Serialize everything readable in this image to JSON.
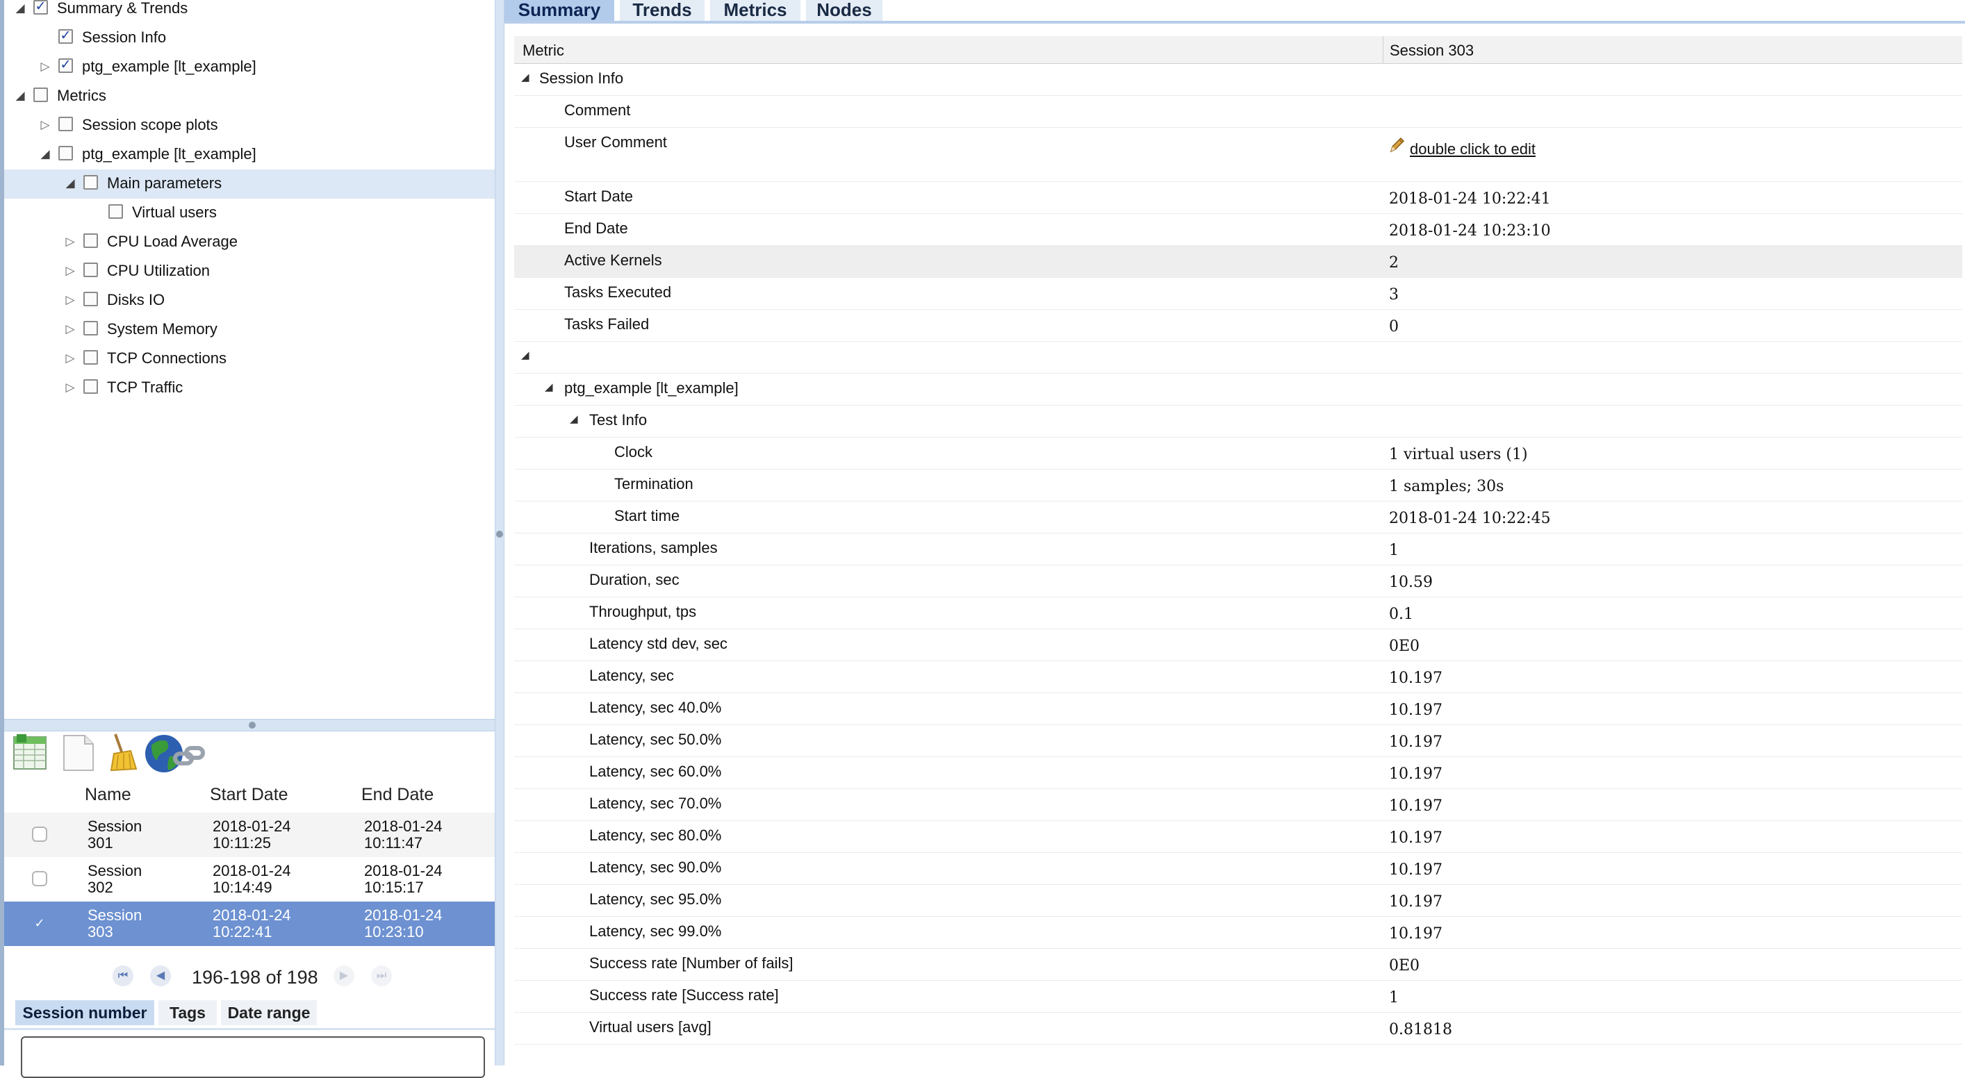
{
  "tree": [
    {
      "label": "Summary & Trends",
      "level": 0,
      "expander": "open",
      "checked": true
    },
    {
      "label": "Session Info",
      "level": 1,
      "expander": "none",
      "checked": true
    },
    {
      "label": "ptg_example [lt_example]",
      "level": 1,
      "expander": "closed",
      "checked": true
    },
    {
      "label": "Metrics",
      "level": 0,
      "expander": "open",
      "checked": false
    },
    {
      "label": "Session scope plots",
      "level": 1,
      "expander": "closed",
      "checked": false
    },
    {
      "label": "ptg_example [lt_example]",
      "level": 1,
      "expander": "open",
      "checked": false
    },
    {
      "label": "Main parameters",
      "level": 2,
      "expander": "open",
      "checked": false,
      "selected": true
    },
    {
      "label": "Virtual users",
      "level": 3,
      "expander": "none",
      "checked": false
    },
    {
      "label": "CPU Load Average",
      "level": 2,
      "expander": "closed",
      "checked": false
    },
    {
      "label": "CPU Utilization",
      "level": 2,
      "expander": "closed",
      "checked": false
    },
    {
      "label": "Disks IO",
      "level": 2,
      "expander": "closed",
      "checked": false
    },
    {
      "label": "System Memory",
      "level": 2,
      "expander": "closed",
      "checked": false
    },
    {
      "label": "TCP Connections",
      "level": 2,
      "expander": "closed",
      "checked": false
    },
    {
      "label": "TCP Traffic",
      "level": 2,
      "expander": "closed",
      "checked": false
    }
  ],
  "toolbar": [
    {
      "icon": "spreadsheet-icon"
    },
    {
      "icon": "blank-document-icon"
    },
    {
      "icon": "broom-icon"
    },
    {
      "icon": "globe-link-icon"
    }
  ],
  "sessions": {
    "headers": {
      "name": "Name",
      "start": "Start Date",
      "end": "End Date"
    },
    "rows": [
      {
        "name1": "Session",
        "name2": "301",
        "start1": "2018-01-24",
        "start2": "10:11:25",
        "end1": "2018-01-24",
        "end2": "10:11:47",
        "checked": false
      },
      {
        "name1": "Session",
        "name2": "302",
        "start1": "2018-01-24",
        "start2": "10:14:49",
        "end1": "2018-01-24",
        "end2": "10:15:17",
        "checked": false
      },
      {
        "name1": "Session",
        "name2": "303",
        "start1": "2018-01-24",
        "start2": "10:22:41",
        "end1": "2018-01-24",
        "end2": "10:23:10",
        "checked": true
      }
    ],
    "pager_text": "196-198 of 198"
  },
  "bottom_tabs": [
    "Session number",
    "Tags",
    "Date range"
  ],
  "main_tabs": [
    "Summary",
    "Trends",
    "Metrics",
    "Nodes"
  ],
  "grid": {
    "header_metric": "Metric",
    "header_session": "Session 303",
    "rows": [
      {
        "name": "Session Info",
        "level": 0,
        "expander": "open",
        "value": ""
      },
      {
        "name": "Comment",
        "level": 1,
        "value": ""
      },
      {
        "name": "User Comment",
        "level": 1,
        "value": "double click to edit",
        "editable": true
      },
      {
        "name": "Start Date",
        "level": 1,
        "value": "2018-01-24 10:22:41"
      },
      {
        "name": "End Date",
        "level": 1,
        "value": "2018-01-24 10:23:10"
      },
      {
        "name": "Active Kernels",
        "level": 1,
        "value": "2",
        "highlight": true
      },
      {
        "name": "Tasks Executed",
        "level": 1,
        "value": "3"
      },
      {
        "name": "Tasks Failed",
        "level": 1,
        "value": "0"
      },
      {
        "name": "",
        "level": 0,
        "expander": "open",
        "value": ""
      },
      {
        "name": "ptg_example [lt_example]",
        "level": 1,
        "expander": "open",
        "value": ""
      },
      {
        "name": "Test Info",
        "level": 2,
        "expander": "open",
        "value": ""
      },
      {
        "name": "Clock",
        "level": 3,
        "value": "1 virtual users (1)"
      },
      {
        "name": "Termination",
        "level": 3,
        "value": "1 samples; 30s"
      },
      {
        "name": "Start time",
        "level": 3,
        "value": "2018-01-24 10:22:45"
      },
      {
        "name": "Iterations, samples",
        "level": 2,
        "value": "1"
      },
      {
        "name": "Duration, sec",
        "level": 2,
        "value": "10.59"
      },
      {
        "name": "Throughput, tps",
        "level": 2,
        "value": "0.1"
      },
      {
        "name": "Latency std dev, sec",
        "level": 2,
        "value": "0E0"
      },
      {
        "name": "Latency, sec",
        "level": 2,
        "value": "10.197"
      },
      {
        "name": "Latency, sec 40.0%",
        "level": 2,
        "value": "10.197"
      },
      {
        "name": "Latency, sec 50.0%",
        "level": 2,
        "value": "10.197"
      },
      {
        "name": "Latency, sec 60.0%",
        "level": 2,
        "value": "10.197"
      },
      {
        "name": "Latency, sec 70.0%",
        "level": 2,
        "value": "10.197"
      },
      {
        "name": "Latency, sec 80.0%",
        "level": 2,
        "value": "10.197"
      },
      {
        "name": "Latency, sec 90.0%",
        "level": 2,
        "value": "10.197"
      },
      {
        "name": "Latency, sec 95.0%",
        "level": 2,
        "value": "10.197"
      },
      {
        "name": "Latency, sec 99.0%",
        "level": 2,
        "value": "10.197"
      },
      {
        "name": "Success rate [Number of fails]",
        "level": 2,
        "value": "0E0"
      },
      {
        "name": "Success rate [Success rate]",
        "level": 2,
        "value": "1"
      },
      {
        "name": "Virtual users [avg]",
        "level": 2,
        "value": "0.81818"
      }
    ]
  }
}
